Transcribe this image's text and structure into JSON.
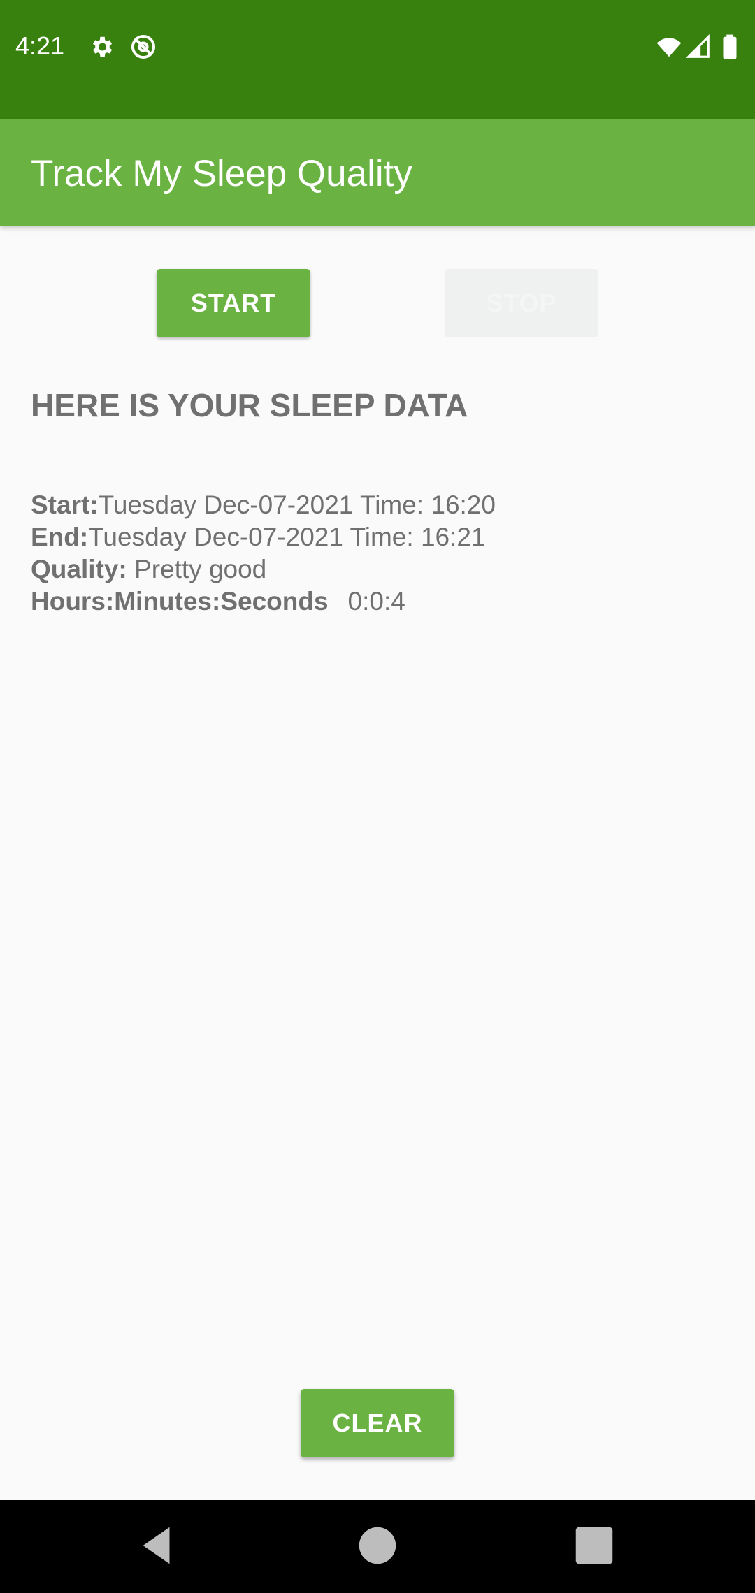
{
  "status_bar": {
    "time": "4:21",
    "icons": [
      "gear-icon",
      "at-sign-icon",
      "wifi-icon",
      "cell-signal-icon",
      "battery-icon"
    ]
  },
  "app_bar": {
    "title": "Track My Sleep Quality"
  },
  "buttons": {
    "start": "START",
    "stop": "STOP",
    "clear": "CLEAR"
  },
  "sleep": {
    "heading": "HERE IS YOUR SLEEP DATA",
    "start_label": "Start:",
    "start_value": "Tuesday Dec-07-2021 Time: 16:20",
    "end_label": "End:",
    "end_value": "Tuesday Dec-07-2021 Time: 16:21",
    "quality_label": "Quality:",
    "quality_value": "Pretty good",
    "hms_label": "Hours:Minutes:Seconds",
    "hms_value": "0:0:4"
  },
  "colors": {
    "status_bar": "#38810F",
    "primary": "#6AB343",
    "text": "#707070",
    "background": "#FAFAFA"
  }
}
